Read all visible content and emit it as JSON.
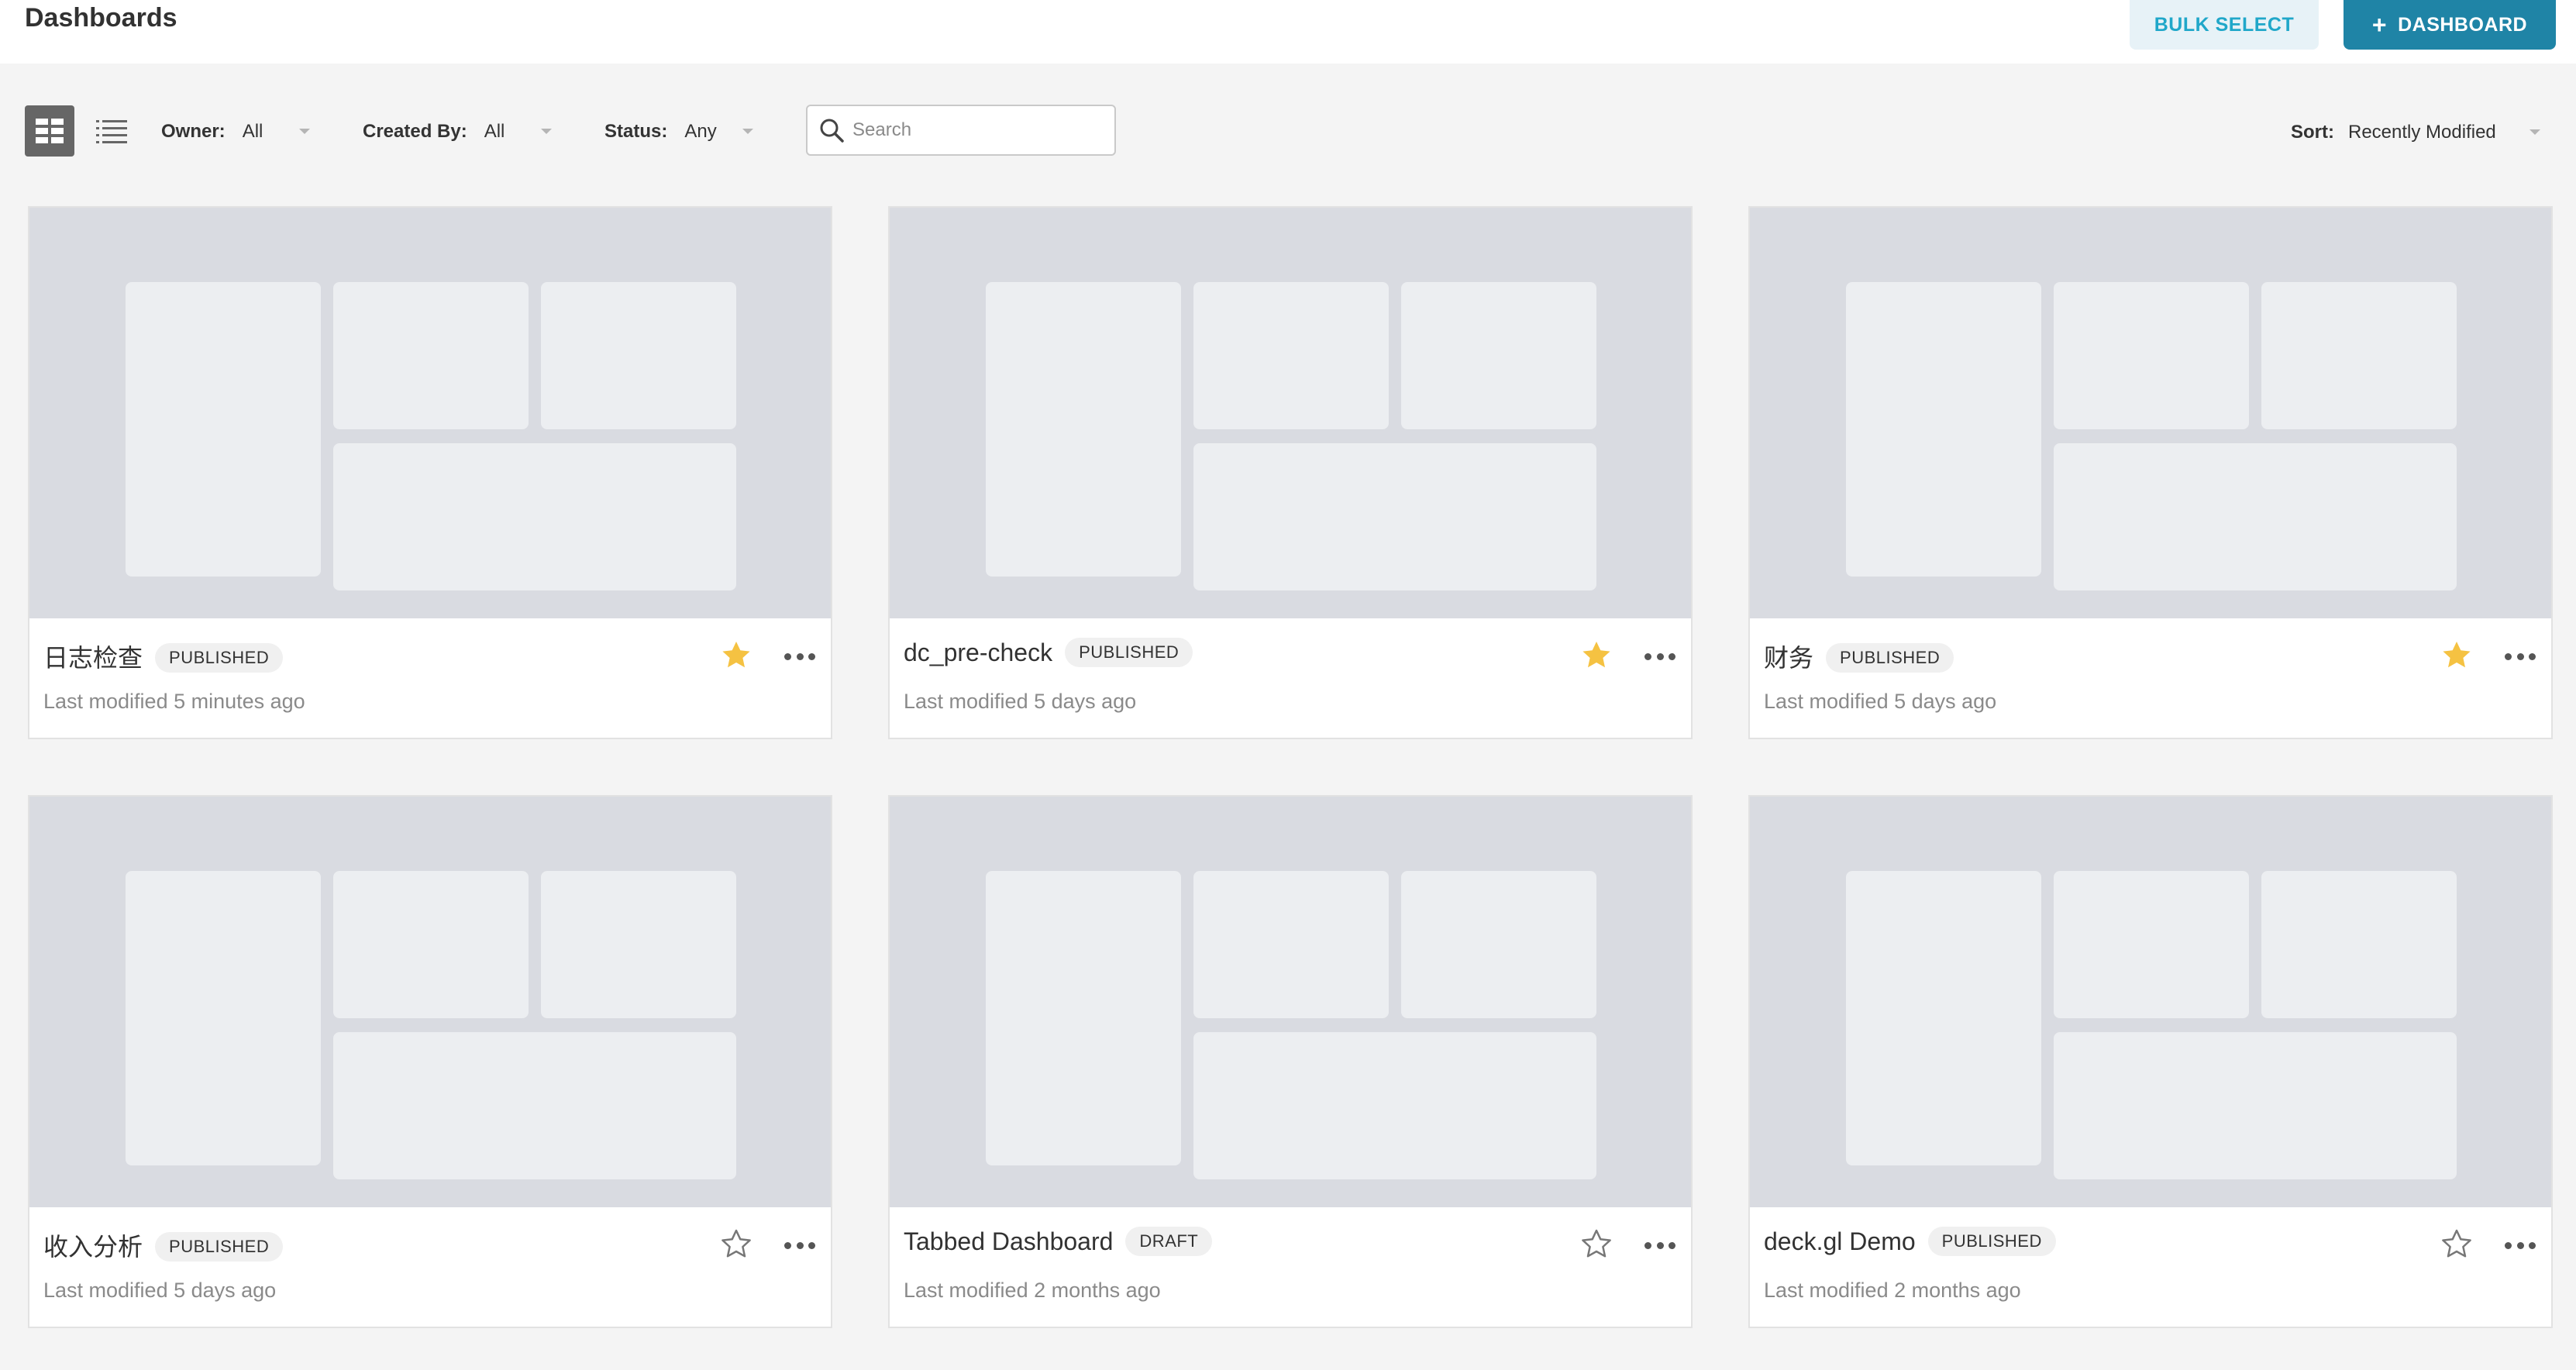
{
  "header": {
    "title": "Dashboards",
    "bulk_select_label": "BULK SELECT",
    "add_dashboard_label": "DASHBOARD",
    "add_icon": "plus-icon"
  },
  "view_toggle": {
    "grid_icon": "grid-view-icon",
    "list_icon": "list-view-icon",
    "active": "grid"
  },
  "filters": {
    "owner": {
      "label": "Owner:",
      "value": "All"
    },
    "created_by": {
      "label": "Created By:",
      "value": "All"
    },
    "status": {
      "label": "Status:",
      "value": "Any"
    },
    "search": {
      "placeholder": "Search",
      "value": ""
    },
    "sort": {
      "label": "Sort:",
      "value": "Recently Modified"
    }
  },
  "colors": {
    "primary": "#1f84a6",
    "bulk_bg": "#e7f2f7",
    "bulk_text": "#20a7c9",
    "star_active": "#f5c242",
    "thumbnail_bg": "#d9dbe1"
  },
  "cards": [
    {
      "title": "日志检查",
      "status": "PUBLISHED",
      "modified": "Last modified 5 minutes ago",
      "favorite": true
    },
    {
      "title": "dc_pre-check",
      "status": "PUBLISHED",
      "modified": "Last modified 5 days ago",
      "favorite": true
    },
    {
      "title": "财务",
      "status": "PUBLISHED",
      "modified": "Last modified 5 days ago",
      "favorite": true
    },
    {
      "title": "收入分析",
      "status": "PUBLISHED",
      "modified": "Last modified 5 days ago",
      "favorite": false
    },
    {
      "title": "Tabbed Dashboard",
      "status": "DRAFT",
      "modified": "Last modified 2 months ago",
      "favorite": false
    },
    {
      "title": "deck.gl Demo",
      "status": "PUBLISHED",
      "modified": "Last modified 2 months ago",
      "favorite": false
    }
  ]
}
